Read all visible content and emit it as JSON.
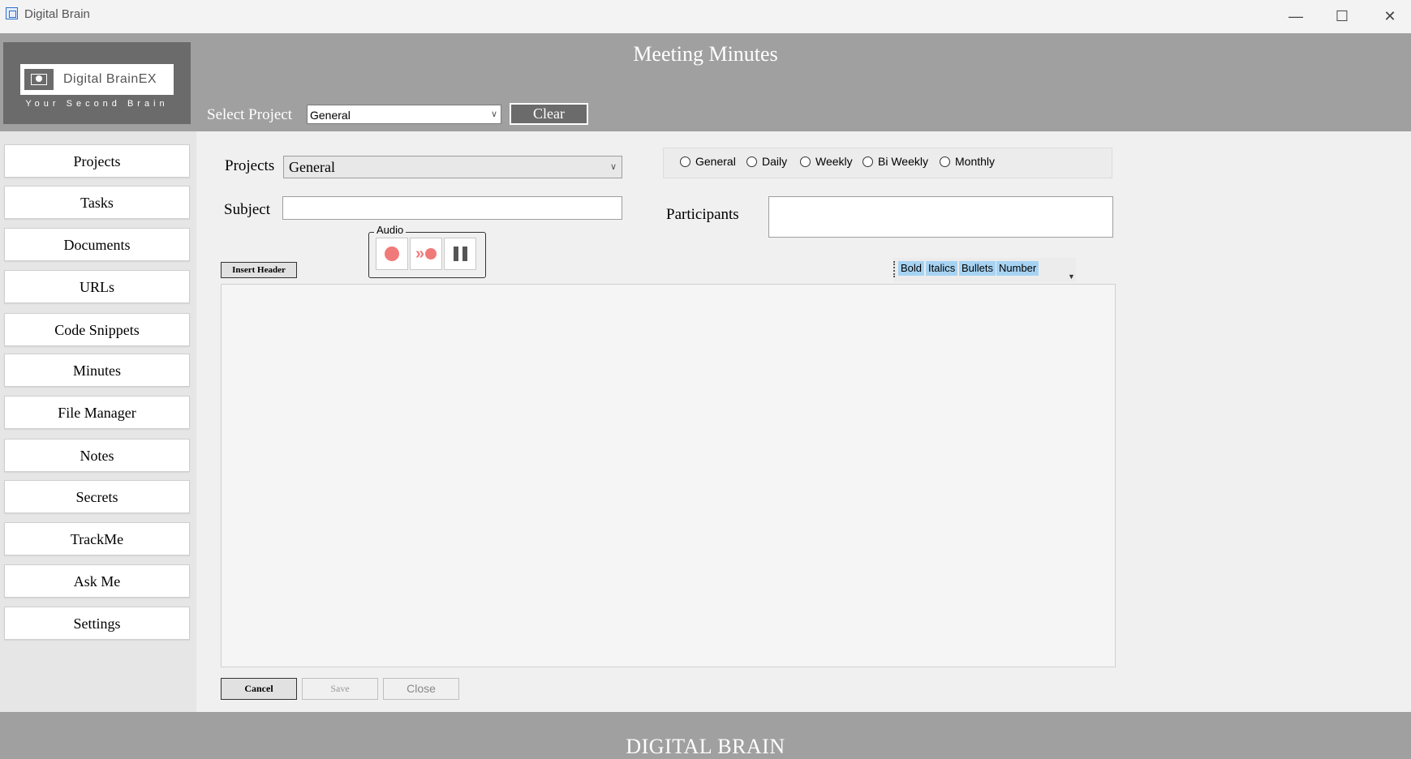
{
  "window": {
    "title": "Digital Brain",
    "controls": {
      "minimize": "—",
      "maximize": "☐",
      "close": "✕"
    }
  },
  "logo": {
    "text": "Digital BrainEX",
    "tagline": "Your Second Brain"
  },
  "header": {
    "title": "Meeting Minutes",
    "select_project_label": "Select Project",
    "select_project_value": "General",
    "clear_label": "Clear"
  },
  "sidebar": {
    "items": [
      {
        "label": "Projects"
      },
      {
        "label": "Tasks"
      },
      {
        "label": "Documents"
      },
      {
        "label": "URLs"
      },
      {
        "label": "Code Snippets"
      },
      {
        "label": "Minutes"
      },
      {
        "label": "File Manager"
      },
      {
        "label": "Notes"
      },
      {
        "label": "Secrets"
      },
      {
        "label": "TrackMe"
      },
      {
        "label": "Ask Me"
      },
      {
        "label": "Settings"
      }
    ]
  },
  "form": {
    "projects_label": "Projects",
    "projects_value": "General",
    "subject_label": "Subject",
    "subject_value": "",
    "participants_label": "Participants",
    "participants_value": "",
    "frequency_options": [
      "General",
      "Daily",
      "Weekly",
      "Bi Weekly",
      "Monthly"
    ],
    "audio_label": "Audio",
    "insert_header_label": "Insert Header",
    "format_buttons": [
      "Bold",
      "Italics",
      "Bullets",
      "Number"
    ],
    "editor_content": ""
  },
  "actions": {
    "cancel": "Cancel",
    "save": "Save",
    "close": "Close"
  },
  "footer": {
    "text": "DIGITAL BRAIN"
  },
  "colors": {
    "header_bg": "#a0a0a0",
    "logo_bg": "#6b6b6b",
    "record_accent": "#f07a7a",
    "format_button_bg": "#a7d3f3"
  }
}
